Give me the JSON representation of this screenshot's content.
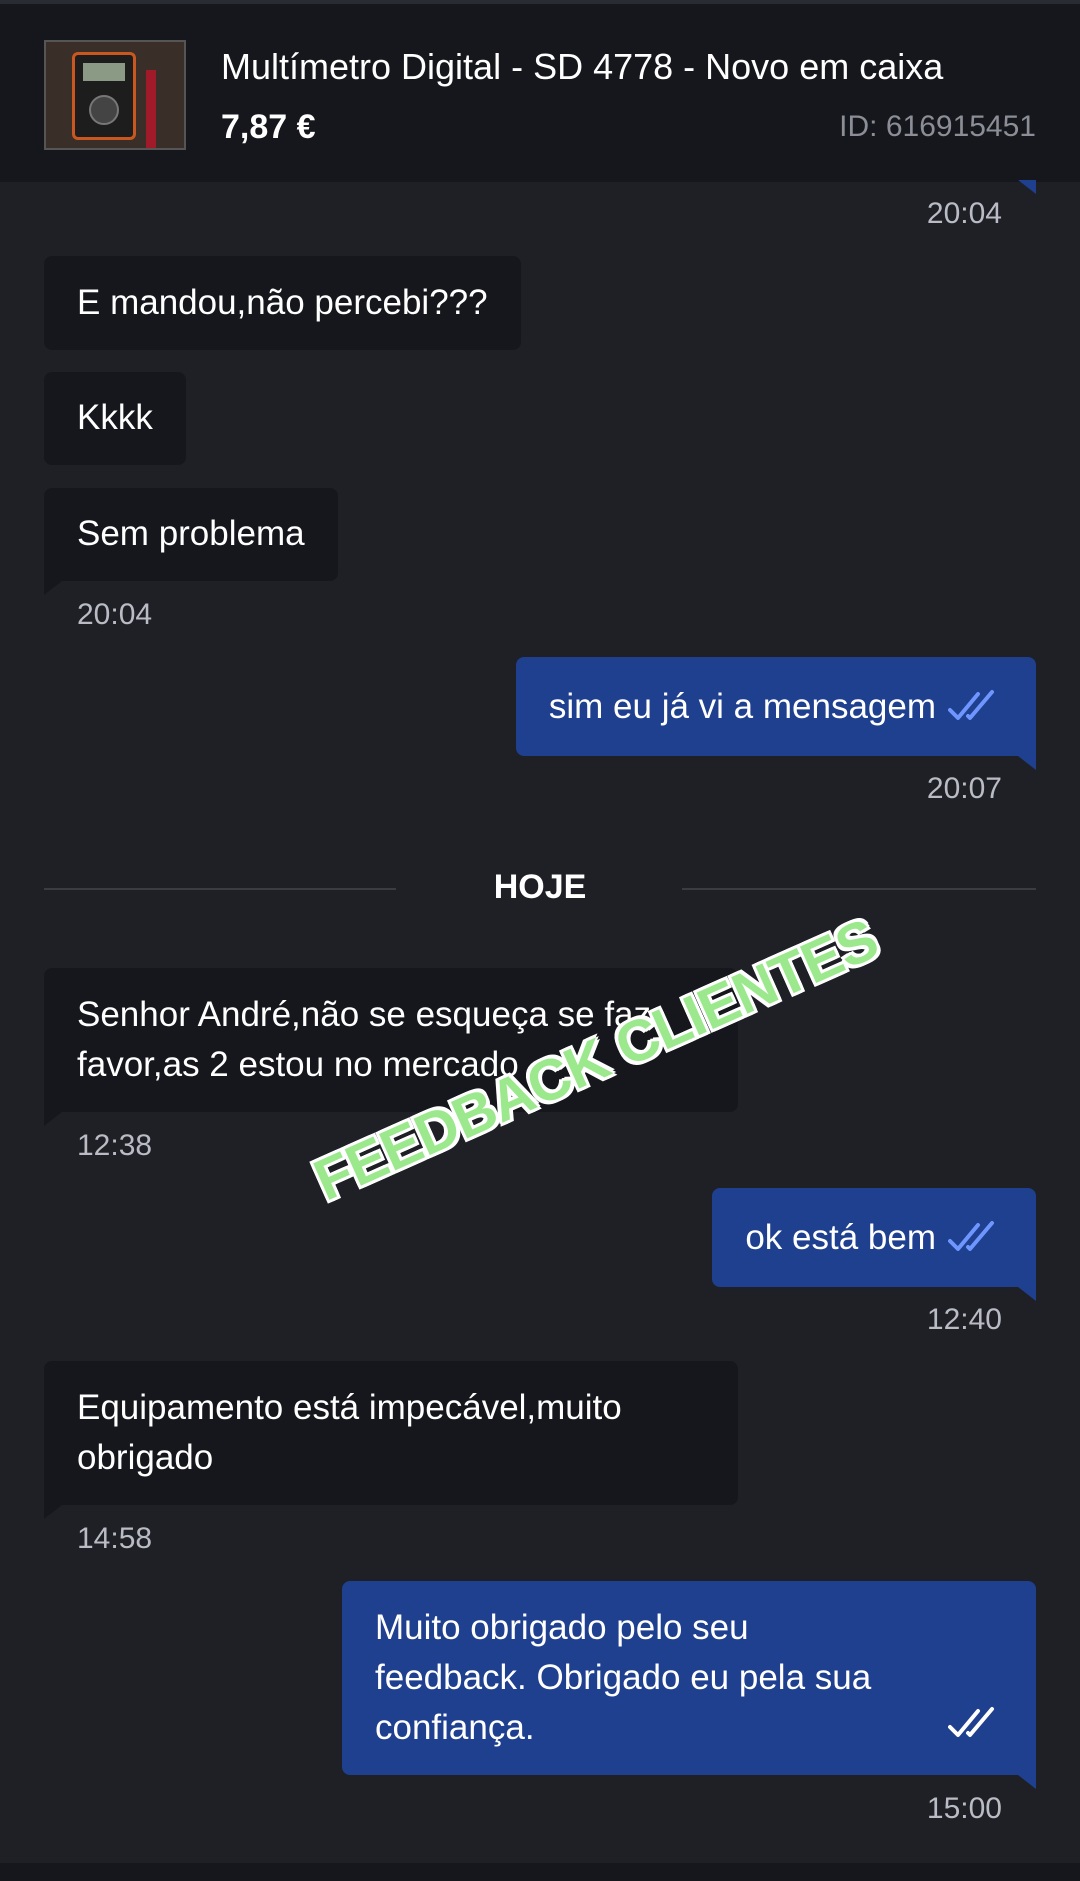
{
  "header": {
    "product_title": "Multímetro Digital - SD 4778  - Novo em caixa",
    "price": "7,87 €",
    "product_id": "ID: 616915451",
    "thumbnail_icon": "multimeter-photo"
  },
  "messages": {
    "m0_time": "20:04",
    "m1": "E mandou,não percebi???",
    "m2": "Kkkk",
    "m3": "Sem problema",
    "m3_time": "20:04",
    "m4": "sim eu já vi a mensagem",
    "m4_time": "20:07",
    "day_separator": "HOJE",
    "m5_line1": "Senhor André,não se esqueça se faz",
    "m5_line2": "favor,as 2 estou no mercado",
    "m5_time": "12:38",
    "m6": "ok está bem",
    "m6_time": "12:40",
    "m7_line1": "Equipamento está impecável,muito",
    "m7_line2": "obrigado",
    "m7_time": "14:58",
    "m8_line1": "Muito obrigado pelo seu",
    "m8_line2": "feedback. Obrigado eu pela sua",
    "m8_line3": "confiança.",
    "m8_time": "15:00"
  },
  "watermark": "FEEDBACK CLIENTES",
  "colors": {
    "background": "#1f2026",
    "incoming_bubble": "#15171c",
    "outgoing_bubble": "#1f3f8f",
    "read_tick": "#6f96ff",
    "watermark": "#9be88d"
  }
}
